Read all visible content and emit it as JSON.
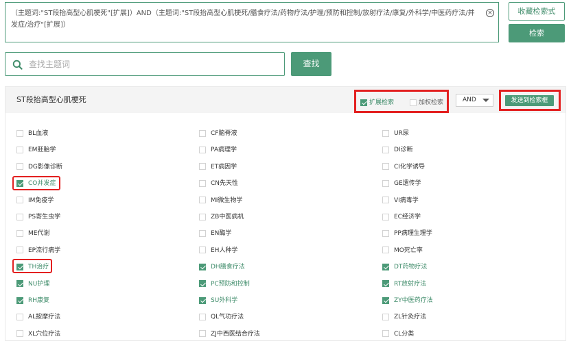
{
  "query": {
    "text": "（主题词:\"ST段抬高型心肌梗死\"[扩展]）AND（主题词:\"ST段抬高型心肌梗死/膳食疗法/药物疗法/护理/预防和控制/放射疗法/康复/外科学/中医药疗法/并发症/治疗\"[扩展]）",
    "clear_icon": "close-circle-icon"
  },
  "buttons": {
    "save_search": "收藏检索式",
    "search": "检索",
    "find": "查找",
    "send": "发送到检索框"
  },
  "topic_search": {
    "placeholder": "查找主题词",
    "icon": "search-icon"
  },
  "panel": {
    "title": "ST段抬高型心肌梗死",
    "expand_label": "扩展检索",
    "expand_checked": true,
    "weight_label": "加权检索",
    "weight_checked": false,
    "operator": "AND"
  },
  "colors": {
    "accent": "#4c9a78",
    "highlight": "#e32020"
  },
  "subheadings": [
    {
      "label": "BL血液",
      "checked": false
    },
    {
      "label": "CF脑脊液",
      "checked": false
    },
    {
      "label": "UR尿",
      "checked": false
    },
    {
      "label": "EM胚胎学",
      "checked": false
    },
    {
      "label": "PA病理学",
      "checked": false
    },
    {
      "label": "DI诊断",
      "checked": false
    },
    {
      "label": "DG影像诊断",
      "checked": false
    },
    {
      "label": "ET病因学",
      "checked": false
    },
    {
      "label": "CI化学诱导",
      "checked": false
    },
    {
      "label": "CO并发症",
      "checked": true
    },
    {
      "label": "CN先天性",
      "checked": false
    },
    {
      "label": "GE遗传学",
      "checked": false
    },
    {
      "label": "IM免疫学",
      "checked": false
    },
    {
      "label": "MI微生物学",
      "checked": false
    },
    {
      "label": "VI病毒学",
      "checked": false
    },
    {
      "label": "PS寄生虫学",
      "checked": false
    },
    {
      "label": "ZB中医病机",
      "checked": false
    },
    {
      "label": "EC经济学",
      "checked": false
    },
    {
      "label": "ME代谢",
      "checked": false
    },
    {
      "label": "EN酶学",
      "checked": false
    },
    {
      "label": "PP病理生理学",
      "checked": false
    },
    {
      "label": "EP流行病学",
      "checked": false
    },
    {
      "label": "EH人种学",
      "checked": false
    },
    {
      "label": "MO死亡率",
      "checked": false
    },
    {
      "label": "TH治疗",
      "checked": true
    },
    {
      "label": "DH膳食疗法",
      "checked": true
    },
    {
      "label": "DT药物疗法",
      "checked": true
    },
    {
      "label": "NU护理",
      "checked": true
    },
    {
      "label": "PC预防和控制",
      "checked": true
    },
    {
      "label": "RT放射疗法",
      "checked": true
    },
    {
      "label": "RH康复",
      "checked": true
    },
    {
      "label": "SU外科学",
      "checked": true
    },
    {
      "label": "ZY中医药疗法",
      "checked": true
    },
    {
      "label": "AL按摩疗法",
      "checked": false
    },
    {
      "label": "QL气功疗法",
      "checked": false
    },
    {
      "label": "ZL针灸疗法",
      "checked": false
    },
    {
      "label": "XL穴位疗法",
      "checked": false
    },
    {
      "label": "ZJ中西医结合疗法",
      "checked": false
    },
    {
      "label": "CL分类",
      "checked": false
    }
  ]
}
